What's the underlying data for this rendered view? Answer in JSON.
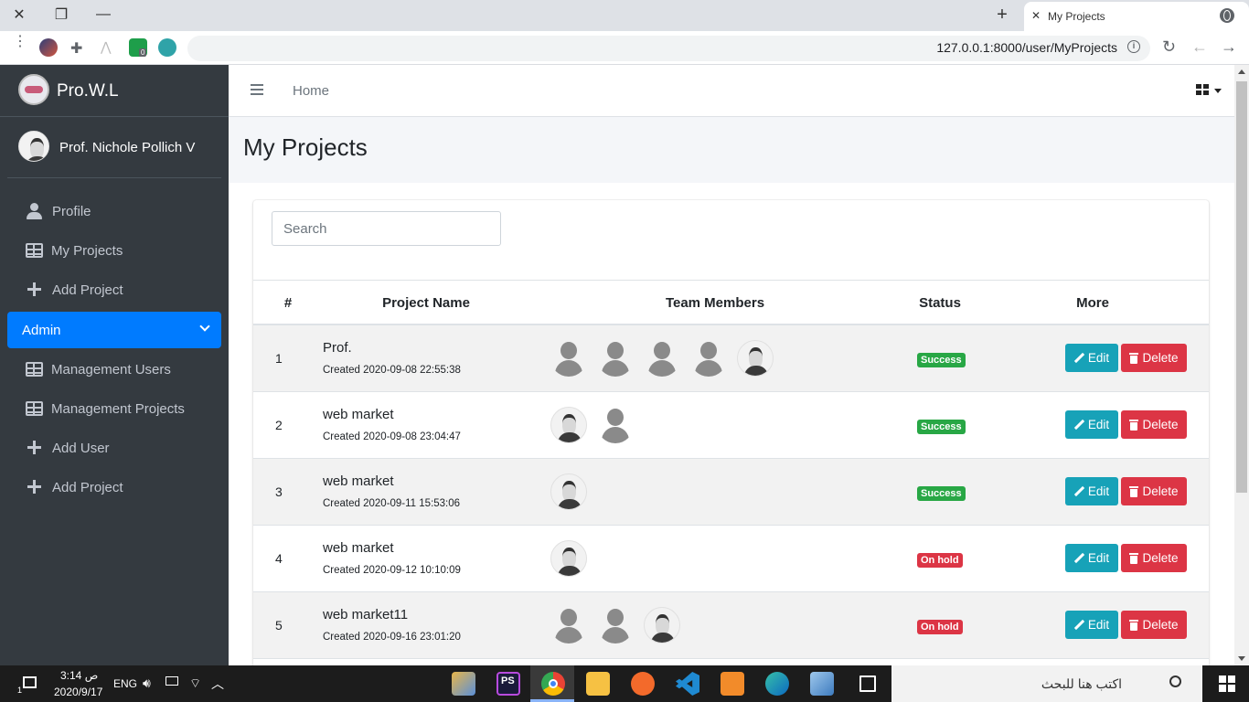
{
  "browser": {
    "tab_title": "My Projects",
    "url": "127.0.0.1:8000/user/MyProjects",
    "extension_badge": "0"
  },
  "sidebar": {
    "brand": "Pro.W.L",
    "user_name": "Prof. Nichole Pollich V",
    "items": [
      {
        "label": "Profile",
        "icon": "user-icon"
      },
      {
        "label": "My Projects",
        "icon": "table-icon"
      },
      {
        "label": "Add Project",
        "icon": "plus-icon"
      },
      {
        "label": "Admin",
        "icon": "chevron-down-icon",
        "active": true
      },
      {
        "label": "Management Users",
        "icon": "table-icon"
      },
      {
        "label": "Management Projects",
        "icon": "table-icon"
      },
      {
        "label": "Add User",
        "icon": "plus-icon"
      },
      {
        "label": "Add Project",
        "icon": "plus-icon"
      }
    ]
  },
  "topnav": {
    "home": "Home"
  },
  "page": {
    "title": "My Projects",
    "search_placeholder": "Search"
  },
  "table": {
    "headers": [
      "#",
      "Project Name",
      "Team Members",
      "Status",
      "More"
    ],
    "edit_label": "Edit",
    "delete_label": "Delete",
    "rows": [
      {
        "num": "1",
        "name": "Prof.",
        "created": "Created 2020-09-08 22:55:38",
        "members": [
          "generic",
          "generic",
          "generic",
          "generic",
          "photo"
        ],
        "status": "Success"
      },
      {
        "num": "2",
        "name": "web market",
        "created": "Created 2020-09-08 23:04:47",
        "members": [
          "photo",
          "generic"
        ],
        "status": "Success"
      },
      {
        "num": "3",
        "name": "web market",
        "created": "Created 2020-09-11 15:53:06",
        "members": [
          "photo"
        ],
        "status": "Success"
      },
      {
        "num": "4",
        "name": "web market",
        "created": "Created 2020-09-12 10:10:09",
        "members": [
          "photo"
        ],
        "status": "On hold"
      },
      {
        "num": "5",
        "name": "web market11",
        "created": "Created 2020-09-16 23:01:20",
        "members": [
          "generic",
          "generic",
          "photo"
        ],
        "status": "On hold"
      }
    ]
  },
  "colors": {
    "sidebar_bg": "#343a40",
    "primary": "#007bff",
    "success": "#28a745",
    "danger": "#dc3545",
    "info": "#17a2b8"
  },
  "taskbar": {
    "time": "3:14 ص",
    "date": "2020/9/17",
    "lang": "ENG",
    "search_text": "اكتب هنا للبحث",
    "notification_count": "1"
  }
}
